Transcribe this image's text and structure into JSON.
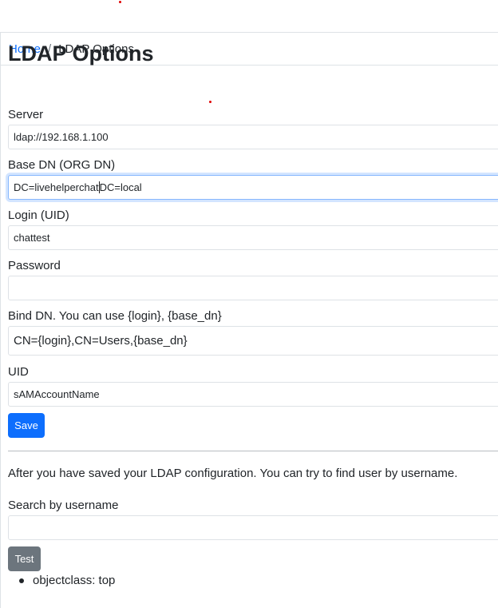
{
  "breadcrumb": {
    "home": "Home",
    "separator": "/",
    "current": "LDAP Options"
  },
  "page_title": "LDAP Options",
  "form": {
    "server": {
      "label": "Server",
      "value": "ldap://192.168.1.100"
    },
    "base_dn": {
      "label": "Base DN (ORG DN)",
      "value_before_caret": "DC=livehelperchat",
      "value_after_caret": "DC=local"
    },
    "login": {
      "label": "Login (UID)",
      "value": "chattest"
    },
    "password": {
      "label": "Password",
      "value": ""
    },
    "bind_dn": {
      "label": "Bind DN. You can use {login}, {base_dn}",
      "value": "CN={login},CN=Users,{base_dn}"
    },
    "uid": {
      "label": "UID",
      "value": "sAMAccountName"
    },
    "save_label": "Save"
  },
  "search": {
    "info": "After you have saved your LDAP configuration. You can try to find user by username.",
    "label": "Search by username",
    "value": "",
    "test_label": "Test"
  },
  "results": [
    {
      "text": "objectclass: top"
    }
  ],
  "colors": {
    "primary": "#0d6efd",
    "secondary": "#6c757d",
    "marker": "#e00000"
  }
}
